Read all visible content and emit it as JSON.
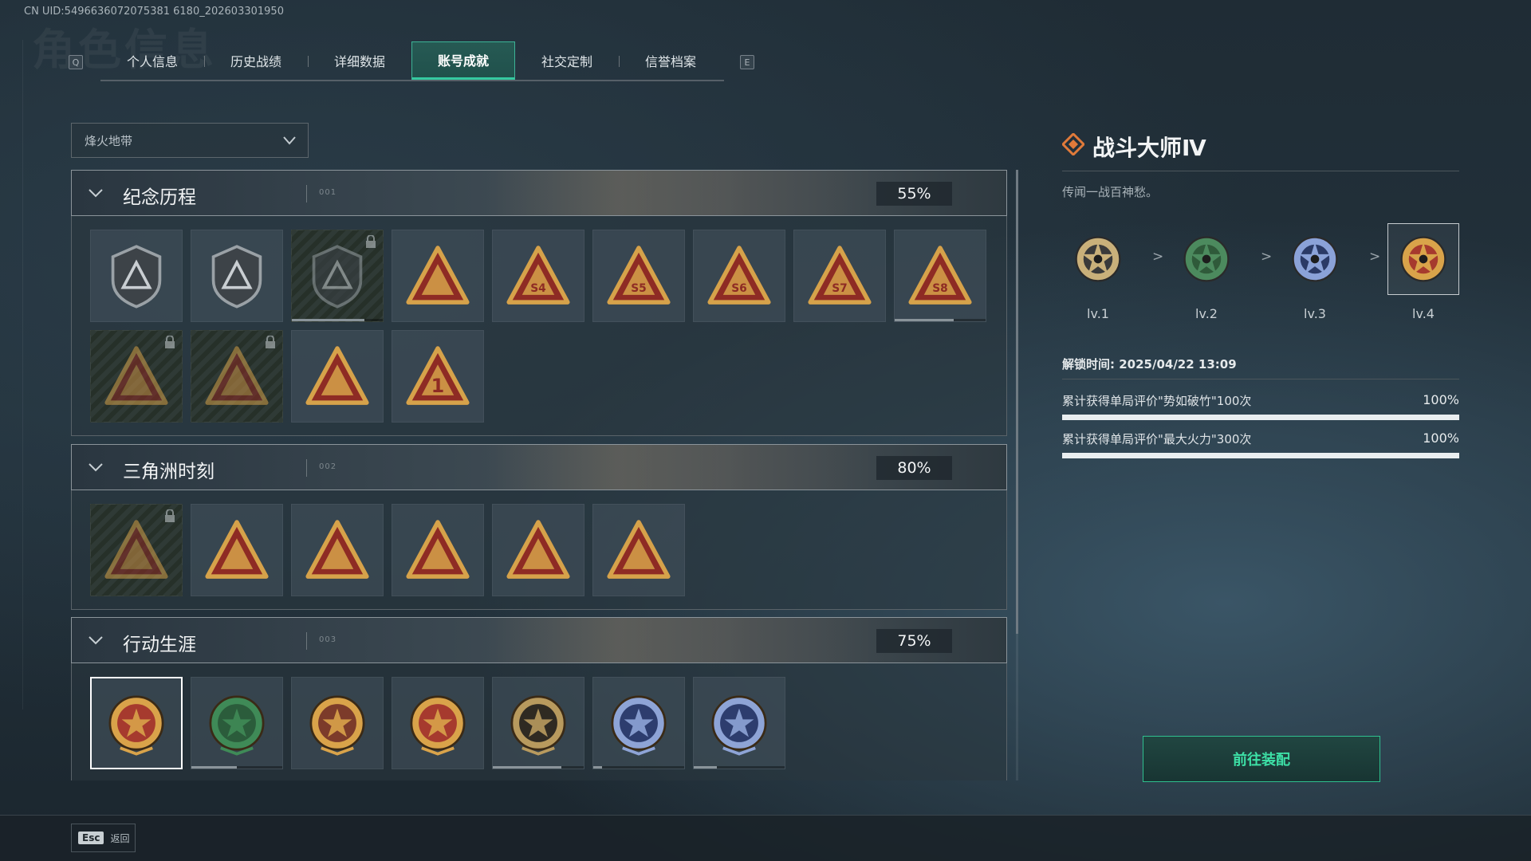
{
  "header": {
    "uid": "CN UID:5496636072075381 6180_202603301950",
    "bg_title": "角色信息",
    "key_left": "Q",
    "key_right": "E",
    "tabs": [
      {
        "label": "个人信息",
        "active": false
      },
      {
        "label": "历史战绩",
        "active": false
      },
      {
        "label": "详细数据",
        "active": false
      },
      {
        "label": "账号成就",
        "active": true
      },
      {
        "label": "社交定制",
        "active": false
      },
      {
        "label": "信誉档案",
        "active": false
      }
    ]
  },
  "filter": {
    "selected": "烽火地带"
  },
  "sections": [
    {
      "title": "纪念历程",
      "code": "001",
      "percent": "55%",
      "badges": [
        {
          "icon": "shield-triangle-emblem",
          "locked": false
        },
        {
          "icon": "helicopter-emblem",
          "locked": false
        },
        {
          "icon": "hex-shield-emblem",
          "locked": true,
          "progress": 0.8
        },
        {
          "icon": "satellite-dish-triangle-badge",
          "locked": false
        },
        {
          "icon": "s4-crate-triangle-badge",
          "locked": false,
          "text": "S4"
        },
        {
          "icon": "s5-bag-triangle-badge",
          "locked": false,
          "text": "S5"
        },
        {
          "icon": "s6-bomb-triangle-badge",
          "locked": false,
          "text": "S6"
        },
        {
          "icon": "s7-canister-triangle-badge",
          "locked": false,
          "text": "S7"
        },
        {
          "icon": "s8-drum-triangle-badge",
          "locked": false,
          "text": "S8",
          "progress": 0.65
        },
        {
          "icon": "hooded-figure-triangle-badge",
          "locked": true
        },
        {
          "icon": "soldier-crossed-rifles-badge",
          "locked": true
        },
        {
          "icon": "boat-triangle-badge",
          "locked": false
        },
        {
          "icon": "number-one-triangle-badge",
          "locked": false,
          "text": "1"
        }
      ]
    },
    {
      "title": "三角洲时刻",
      "code": "002",
      "percent": "80%",
      "badges": [
        {
          "icon": "usb-triangle-badge",
          "locked": true
        },
        {
          "icon": "shield-operator-triangle-badge",
          "locked": false
        },
        {
          "icon": "crouching-soldier-triangle-badge",
          "locked": false
        },
        {
          "icon": "gem-triangle-badge",
          "locked": false
        },
        {
          "icon": "squad-triangle-badge",
          "locked": false
        },
        {
          "icon": "rocket-triangle-badge",
          "locked": false
        }
      ]
    },
    {
      "title": "行动生涯",
      "code": "003",
      "percent": "75%",
      "badges": [
        {
          "icon": "combat-master-star-medal",
          "locked": false,
          "selected": true
        },
        {
          "icon": "green-shield-medal",
          "locked": false,
          "progress": 0.5
        },
        {
          "icon": "blue-ribbon-medal",
          "locked": false
        },
        {
          "icon": "gem-ribbon-medal",
          "locked": false
        },
        {
          "icon": "ring-medal",
          "locked": false,
          "progress": 0.75
        },
        {
          "icon": "skull-blue-medal",
          "locked": false,
          "progress": 0.1
        },
        {
          "icon": "eye-blue-medal",
          "locked": false,
          "progress": 0.25
        }
      ]
    }
  ],
  "detail": {
    "title": "战斗大师Ⅳ",
    "description": "传闻一战百神愁。",
    "levels": [
      {
        "label": "lv.1",
        "color": "#c9b07a",
        "inner": "#3a3a3a"
      },
      {
        "label": "lv.2",
        "color": "#4c8a5e",
        "inner": "#2f5a3a"
      },
      {
        "label": "lv.3",
        "color": "#8ba2d8",
        "inner": "#2b3a66"
      },
      {
        "label": "lv.4",
        "color": "#d9a34a",
        "inner": "#a63a2e",
        "current": true
      }
    ],
    "arrow": ">",
    "unlock_time": "解锁时间: 2025/04/22 13:09",
    "requirements": [
      {
        "text": "累计获得单局评价\"势如破竹\"100次",
        "value": "100%",
        "progress": 1.0
      },
      {
        "text": "累计获得单局评价\"最大火力\"300次",
        "value": "100%",
        "progress": 1.0
      }
    ],
    "equip_button": "前往装配"
  },
  "footer": {
    "esc_key": "Esc",
    "esc_label": "返回"
  },
  "colors": {
    "accent": "#35c9a0",
    "badge_gold": "#d6a24a",
    "badge_red": "#8e2b24",
    "orange_diamond": "#e07a3a"
  }
}
